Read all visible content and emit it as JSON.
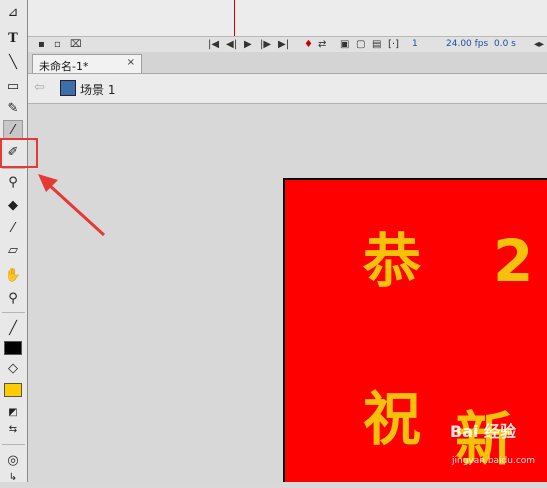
{
  "timeline": {
    "frame_number": "1",
    "fps": "24.00 fps",
    "time": "0.0 s"
  },
  "document_tab": {
    "title": "未命名-1*",
    "close_symbol": "×"
  },
  "edit_bar": {
    "back_symbol": "⇦",
    "scene_label": "场景 1"
  },
  "stage": {
    "characters": [
      "恭",
      "2",
      "祝",
      "新"
    ]
  },
  "watermark": {
    "text": "Bai 经验",
    "url": "jingyan.baidu.com"
  },
  "tools": [
    "subselection-icon",
    "text-tool-icon",
    "line-tool-icon",
    "rectangle-tool-icon",
    "pencil-tool-icon",
    "brush-tool-icon",
    "deco-tool-icon",
    "bone-tool-icon",
    "paint-bucket-icon",
    "eyedropper-icon",
    "eraser-icon",
    "hand-tool-icon",
    "zoom-tool-icon",
    "stroke-color-icon",
    "fill-color-icon"
  ],
  "colors": {
    "stroke": "#000000",
    "fill": "#ffcc00",
    "stage": "#ff0000",
    "text": "#f4c20b",
    "annotation": "#e53935"
  }
}
